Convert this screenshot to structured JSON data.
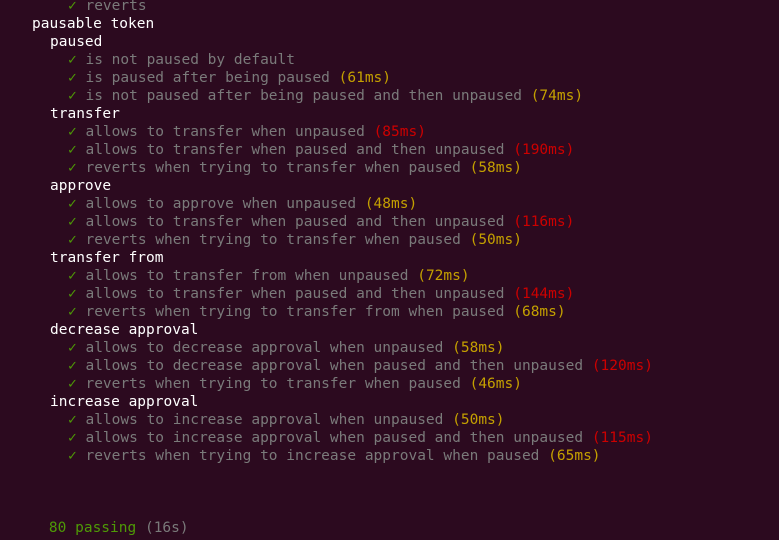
{
  "terminal": {
    "background": "#2c0a1f",
    "colors": {
      "suite": "#ffffff",
      "check": "#4e9a06",
      "test_title": "#7a7a7a",
      "duration_medium": "#c4a000",
      "duration_slow": "#cc0000",
      "passing": "#4e9a06"
    },
    "lines": [
      {
        "kind": "test",
        "check": "✓",
        "title": "reverts",
        "duration": ""
      },
      {
        "kind": "suite",
        "text": "pausable token"
      },
      {
        "kind": "subsuite",
        "text": "paused"
      },
      {
        "kind": "test",
        "check": "✓",
        "title": "is not paused by default",
        "duration": ""
      },
      {
        "kind": "test",
        "check": "✓",
        "title": "is paused after being paused",
        "duration": "(61ms)",
        "speed": "medium"
      },
      {
        "kind": "test",
        "check": "✓",
        "title": "is not paused after being paused and then unpaused",
        "duration": "(74ms)",
        "speed": "medium"
      },
      {
        "kind": "subsuite",
        "text": "transfer"
      },
      {
        "kind": "test",
        "check": "✓",
        "title": "allows to transfer when unpaused",
        "duration": "(85ms)",
        "speed": "slow"
      },
      {
        "kind": "test",
        "check": "✓",
        "title": "allows to transfer when paused and then unpaused",
        "duration": "(190ms)",
        "speed": "slow"
      },
      {
        "kind": "test",
        "check": "✓",
        "title": "reverts when trying to transfer when paused",
        "duration": "(58ms)",
        "speed": "medium"
      },
      {
        "kind": "subsuite",
        "text": "approve"
      },
      {
        "kind": "test",
        "check": "✓",
        "title": "allows to approve when unpaused",
        "duration": "(48ms)",
        "speed": "medium"
      },
      {
        "kind": "test",
        "check": "✓",
        "title": "allows to transfer when paused and then unpaused",
        "duration": "(116ms)",
        "speed": "slow"
      },
      {
        "kind": "test",
        "check": "✓",
        "title": "reverts when trying to transfer when paused",
        "duration": "(50ms)",
        "speed": "medium"
      },
      {
        "kind": "subsuite",
        "text": "transfer from"
      },
      {
        "kind": "test",
        "check": "✓",
        "title": "allows to transfer from when unpaused",
        "duration": "(72ms)",
        "speed": "medium"
      },
      {
        "kind": "test",
        "check": "✓",
        "title": "allows to transfer when paused and then unpaused",
        "duration": "(144ms)",
        "speed": "slow"
      },
      {
        "kind": "test",
        "check": "✓",
        "title": "reverts when trying to transfer from when paused",
        "duration": "(68ms)",
        "speed": "medium"
      },
      {
        "kind": "subsuite",
        "text": "decrease approval"
      },
      {
        "kind": "test",
        "check": "✓",
        "title": "allows to decrease approval when unpaused",
        "duration": "(58ms)",
        "speed": "medium"
      },
      {
        "kind": "test",
        "check": "✓",
        "title": "allows to decrease approval when paused and then unpaused",
        "duration": "(120ms)",
        "speed": "slow"
      },
      {
        "kind": "test",
        "check": "✓",
        "title": "reverts when trying to transfer when paused",
        "duration": "(46ms)",
        "speed": "medium"
      },
      {
        "kind": "subsuite",
        "text": "increase approval"
      },
      {
        "kind": "test",
        "check": "✓",
        "title": "allows to increase approval when unpaused",
        "duration": "(50ms)",
        "speed": "medium"
      },
      {
        "kind": "test",
        "check": "✓",
        "title": "allows to increase approval when paused and then unpaused",
        "duration": "(115ms)",
        "speed": "slow"
      },
      {
        "kind": "test",
        "check": "✓",
        "title": "reverts when trying to increase approval when paused",
        "duration": "(65ms)",
        "speed": "medium"
      }
    ],
    "summary": {
      "passing": "80 passing",
      "total_time": "(16s)"
    }
  }
}
